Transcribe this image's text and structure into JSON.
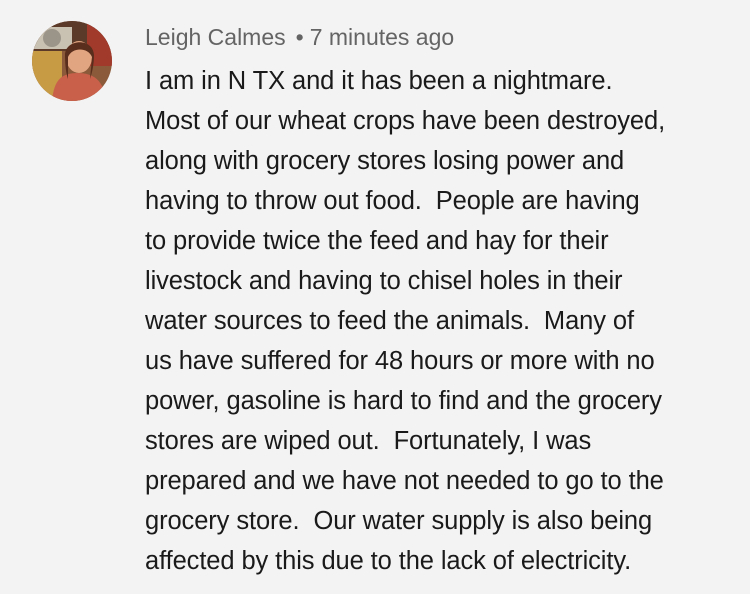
{
  "comment": {
    "author": "Leigh Calmes",
    "separator": "•",
    "timestamp": "7 minutes ago",
    "avatar_icon": "user-avatar-photo",
    "lines": [
      "I am in N TX and it has been a nightmare.",
      "Most of our wheat crops have been destroyed,",
      "along with grocery stores losing power and",
      "having to throw out food.  People are having",
      "to provide twice the feed and hay for their",
      "livestock and having to chisel holes in their",
      "water sources to feed the animals.  Many of",
      "us have suffered for 48 hours or more with no",
      "power, gasoline is hard to find and the grocery",
      "stores are wiped out.  Fortunately, I was",
      "prepared and we have not needed to go to the",
      "grocery store.  Our water supply is also being",
      "affected by this due to the lack of electricity."
    ]
  }
}
